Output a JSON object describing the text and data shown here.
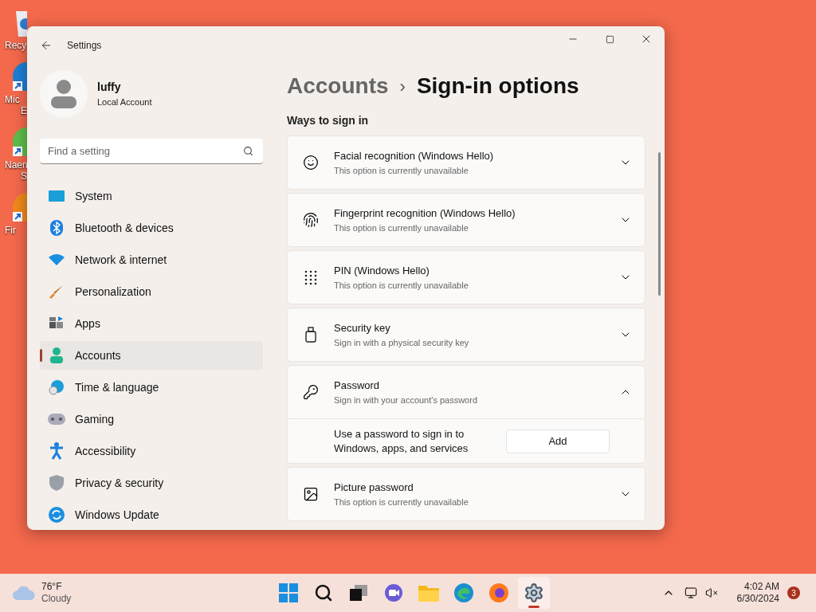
{
  "desktop_icons": [
    {
      "lines": [
        "Recy"
      ]
    },
    {
      "lines": [
        "Mic",
        "E"
      ]
    },
    {
      "lines": [
        "Naen",
        "S"
      ]
    },
    {
      "lines": [
        "Fir"
      ]
    }
  ],
  "window": {
    "title": "Settings"
  },
  "profile": {
    "name": "luffy",
    "account_type": "Local Account"
  },
  "search": {
    "placeholder": "Find a setting"
  },
  "nav_items": [
    {
      "label": "System",
      "selected": false
    },
    {
      "label": "Bluetooth & devices",
      "selected": false
    },
    {
      "label": "Network & internet",
      "selected": false
    },
    {
      "label": "Personalization",
      "selected": false
    },
    {
      "label": "Apps",
      "selected": false
    },
    {
      "label": "Accounts",
      "selected": true
    },
    {
      "label": "Time & language",
      "selected": false
    },
    {
      "label": "Gaming",
      "selected": false
    },
    {
      "label": "Accessibility",
      "selected": false
    },
    {
      "label": "Privacy & security",
      "selected": false
    },
    {
      "label": "Windows Update",
      "selected": false
    }
  ],
  "breadcrumb": {
    "parent": "Accounts",
    "separator": "›",
    "current": "Sign-in options"
  },
  "section_title": "Ways to sign in",
  "options": [
    {
      "title": "Facial recognition (Windows Hello)",
      "subtitle": "This option is currently unavailable",
      "expanded": false
    },
    {
      "title": "Fingerprint recognition (Windows Hello)",
      "subtitle": "This option is currently unavailable",
      "expanded": false
    },
    {
      "title": "PIN (Windows Hello)",
      "subtitle": "This option is currently unavailable",
      "expanded": false
    },
    {
      "title": "Security key",
      "subtitle": "Sign in with a physical security key",
      "expanded": false
    },
    {
      "title": "Password",
      "subtitle": "Sign in with your account's password",
      "expanded": true,
      "detail": {
        "text": "Use a password to sign in to Windows, apps, and services",
        "button": "Add"
      }
    },
    {
      "title": "Picture password",
      "subtitle": "This option is currently unavailable",
      "expanded": false
    }
  ],
  "taskbar": {
    "weather": {
      "temperature": "76°F",
      "condition": "Cloudy"
    },
    "apps": [
      {
        "selected": false
      },
      {
        "selected": false
      },
      {
        "selected": false
      },
      {
        "selected": false
      },
      {
        "selected": false
      },
      {
        "selected": false
      },
      {
        "selected": false
      },
      {
        "selected": true
      }
    ],
    "time": "4:02 AM",
    "date": "6/30/2024",
    "notification_count": "3"
  }
}
